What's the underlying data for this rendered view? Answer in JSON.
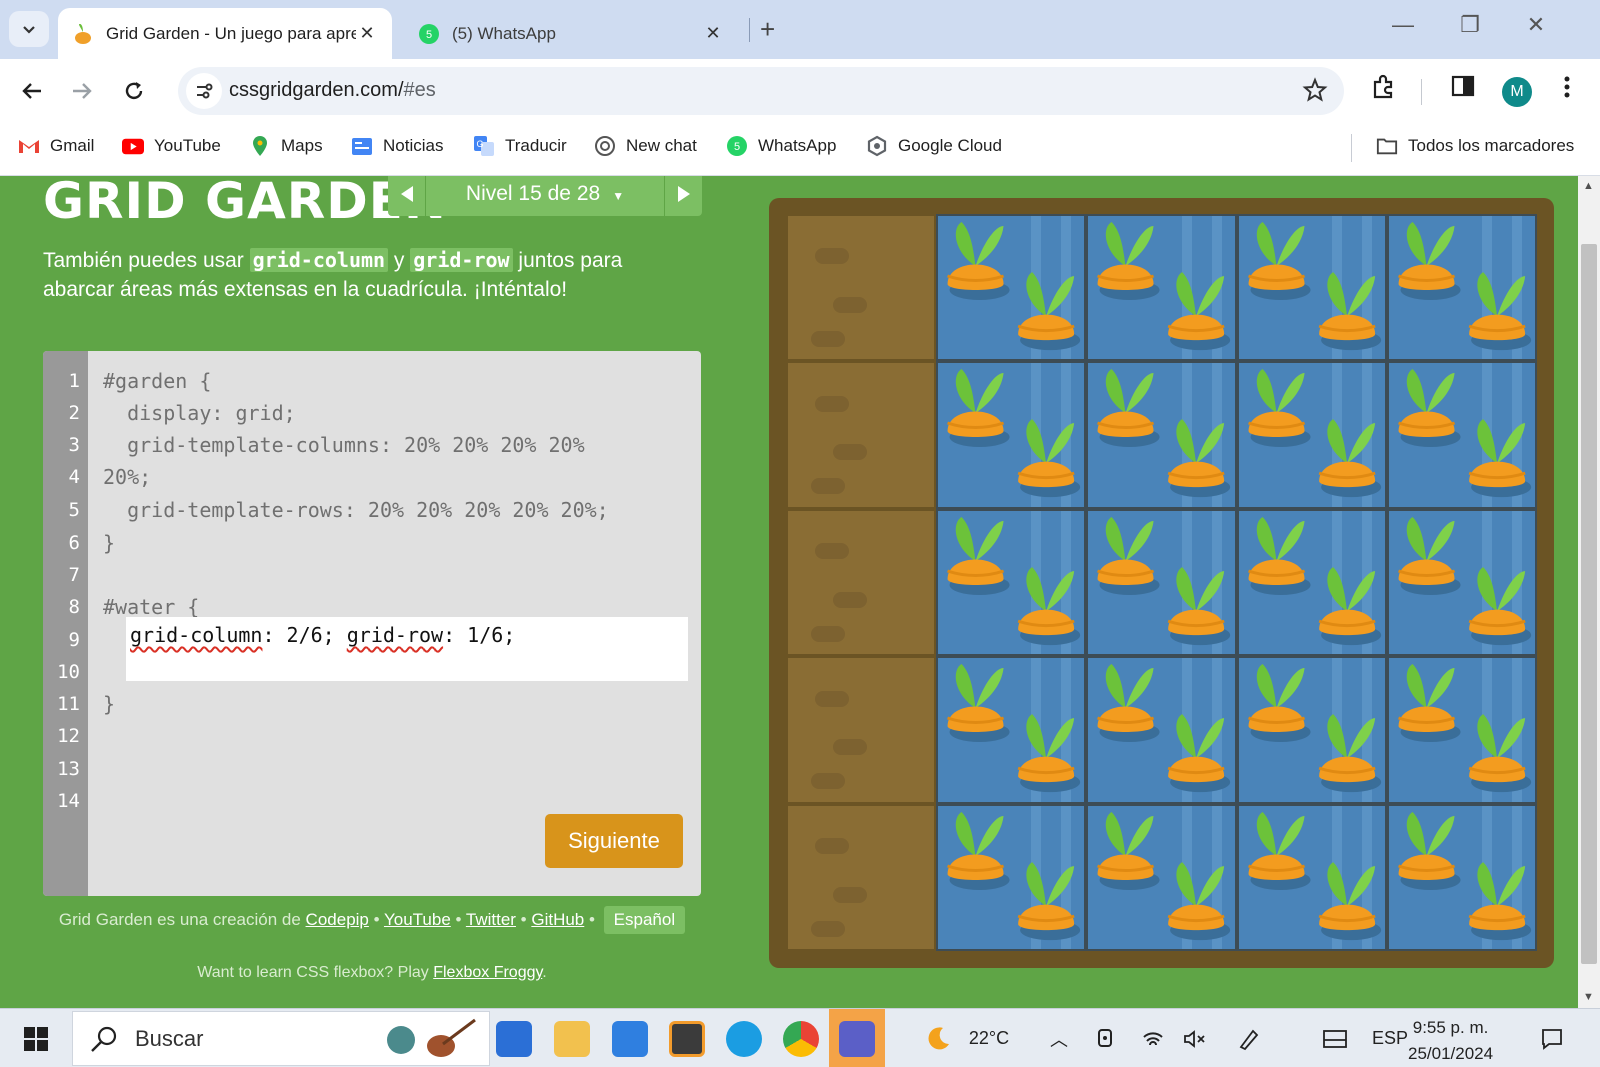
{
  "browser": {
    "tabs": [
      {
        "title": "Grid Garden - Un juego para aprender CSS grid",
        "active": true,
        "icon": "carrot-icon"
      },
      {
        "title": "(5) WhatsApp",
        "active": false,
        "icon": "whatsapp-icon"
      }
    ],
    "url_host": "cssgridgarden.com/",
    "url_path": "#es",
    "profile_initial": "M"
  },
  "bookmarks": [
    {
      "label": "Gmail",
      "icon": "gmail-icon"
    },
    {
      "label": "YouTube",
      "icon": "youtube-icon"
    },
    {
      "label": "Maps",
      "icon": "maps-icon"
    },
    {
      "label": "Noticias",
      "icon": "news-icon"
    },
    {
      "label": "Traducir",
      "icon": "translate-icon"
    },
    {
      "label": "New chat",
      "icon": "chatgpt-icon"
    },
    {
      "label": "WhatsApp",
      "icon": "whatsapp-icon"
    },
    {
      "label": "Google Cloud",
      "icon": "gcloud-icon"
    }
  ],
  "all_bookmarks_label": "Todos los marcadores",
  "game": {
    "logo": "GRID GARDEN",
    "level_label": "Nivel 15 de 28",
    "instructions": {
      "before": "También puedes usar ",
      "code1": "grid-column",
      "mid": " y ",
      "code2": "grid-row",
      "after": " juntos para abarcar áreas más extensas en la cuadrícula. ¡Inténtalo!"
    },
    "line_numbers": [
      "1",
      "2",
      "3",
      "4",
      "5",
      "6",
      "7",
      "8",
      "9",
      "10",
      "11",
      "12",
      "13",
      "14"
    ],
    "code_lines": [
      "#garden {",
      "  display: grid;",
      "  grid-template-columns: 20% 20% 20% 20%",
      "20%;",
      "  grid-template-rows: 20% 20% 20% 20% 20%;",
      "}",
      "",
      "#water {",
      "}"
    ],
    "input": {
      "p1": "grid-column",
      "p2": ": 2/6; ",
      "p3": "grid-row",
      "p4": ": 1/6;"
    },
    "next_button": "Siguiente",
    "credits": {
      "prefix": "Grid Garden es una creación de ",
      "codepip": "Codepip",
      "youtube": "YouTube",
      "twitter": "Twitter",
      "github": "GitHub",
      "sep": " • ",
      "language": "Español"
    },
    "flexbox": {
      "prefix": "Want to learn CSS flexbox? Play ",
      "link": "Flexbox Froggy",
      "suffix": "."
    },
    "garden": {
      "columns": 5,
      "rows": 5,
      "water_column_start": 2,
      "water_column_end": 6,
      "water_row_start": 1,
      "water_row_end": 6
    }
  },
  "taskbar": {
    "search_placeholder": "Buscar",
    "weather": "22°C",
    "language": "ESP",
    "time": "9:55 p. m.",
    "date": "25/01/2024"
  }
}
